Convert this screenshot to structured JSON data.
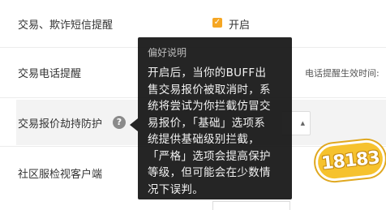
{
  "settings": {
    "rows": [
      {
        "label": "交易、欺诈短信提醒"
      },
      {
        "label": "交易电话提醒"
      },
      {
        "label": "交易报价劫持防护"
      },
      {
        "label": "社区服检视客户端"
      }
    ],
    "sms_checkbox": {
      "label": "开启",
      "checked": true
    },
    "phone_effective_label": "电话提醒生效时间:"
  },
  "tooltip": {
    "title": "偏好说明",
    "body": "开启后，当你的BUFF出\n售交易报价被取消时，系\n统将尝试为你拦截仿冒交\n易报价，「基础」选项系\n统提供基础级别拦截，\n「严格」选项会提高保护\n等级，但可能会在少数情\n况下误判。"
  },
  "watermark": {
    "text": "18183"
  },
  "colors": {
    "accent": "#f5a623",
    "tooltip_bg": "#121212"
  }
}
